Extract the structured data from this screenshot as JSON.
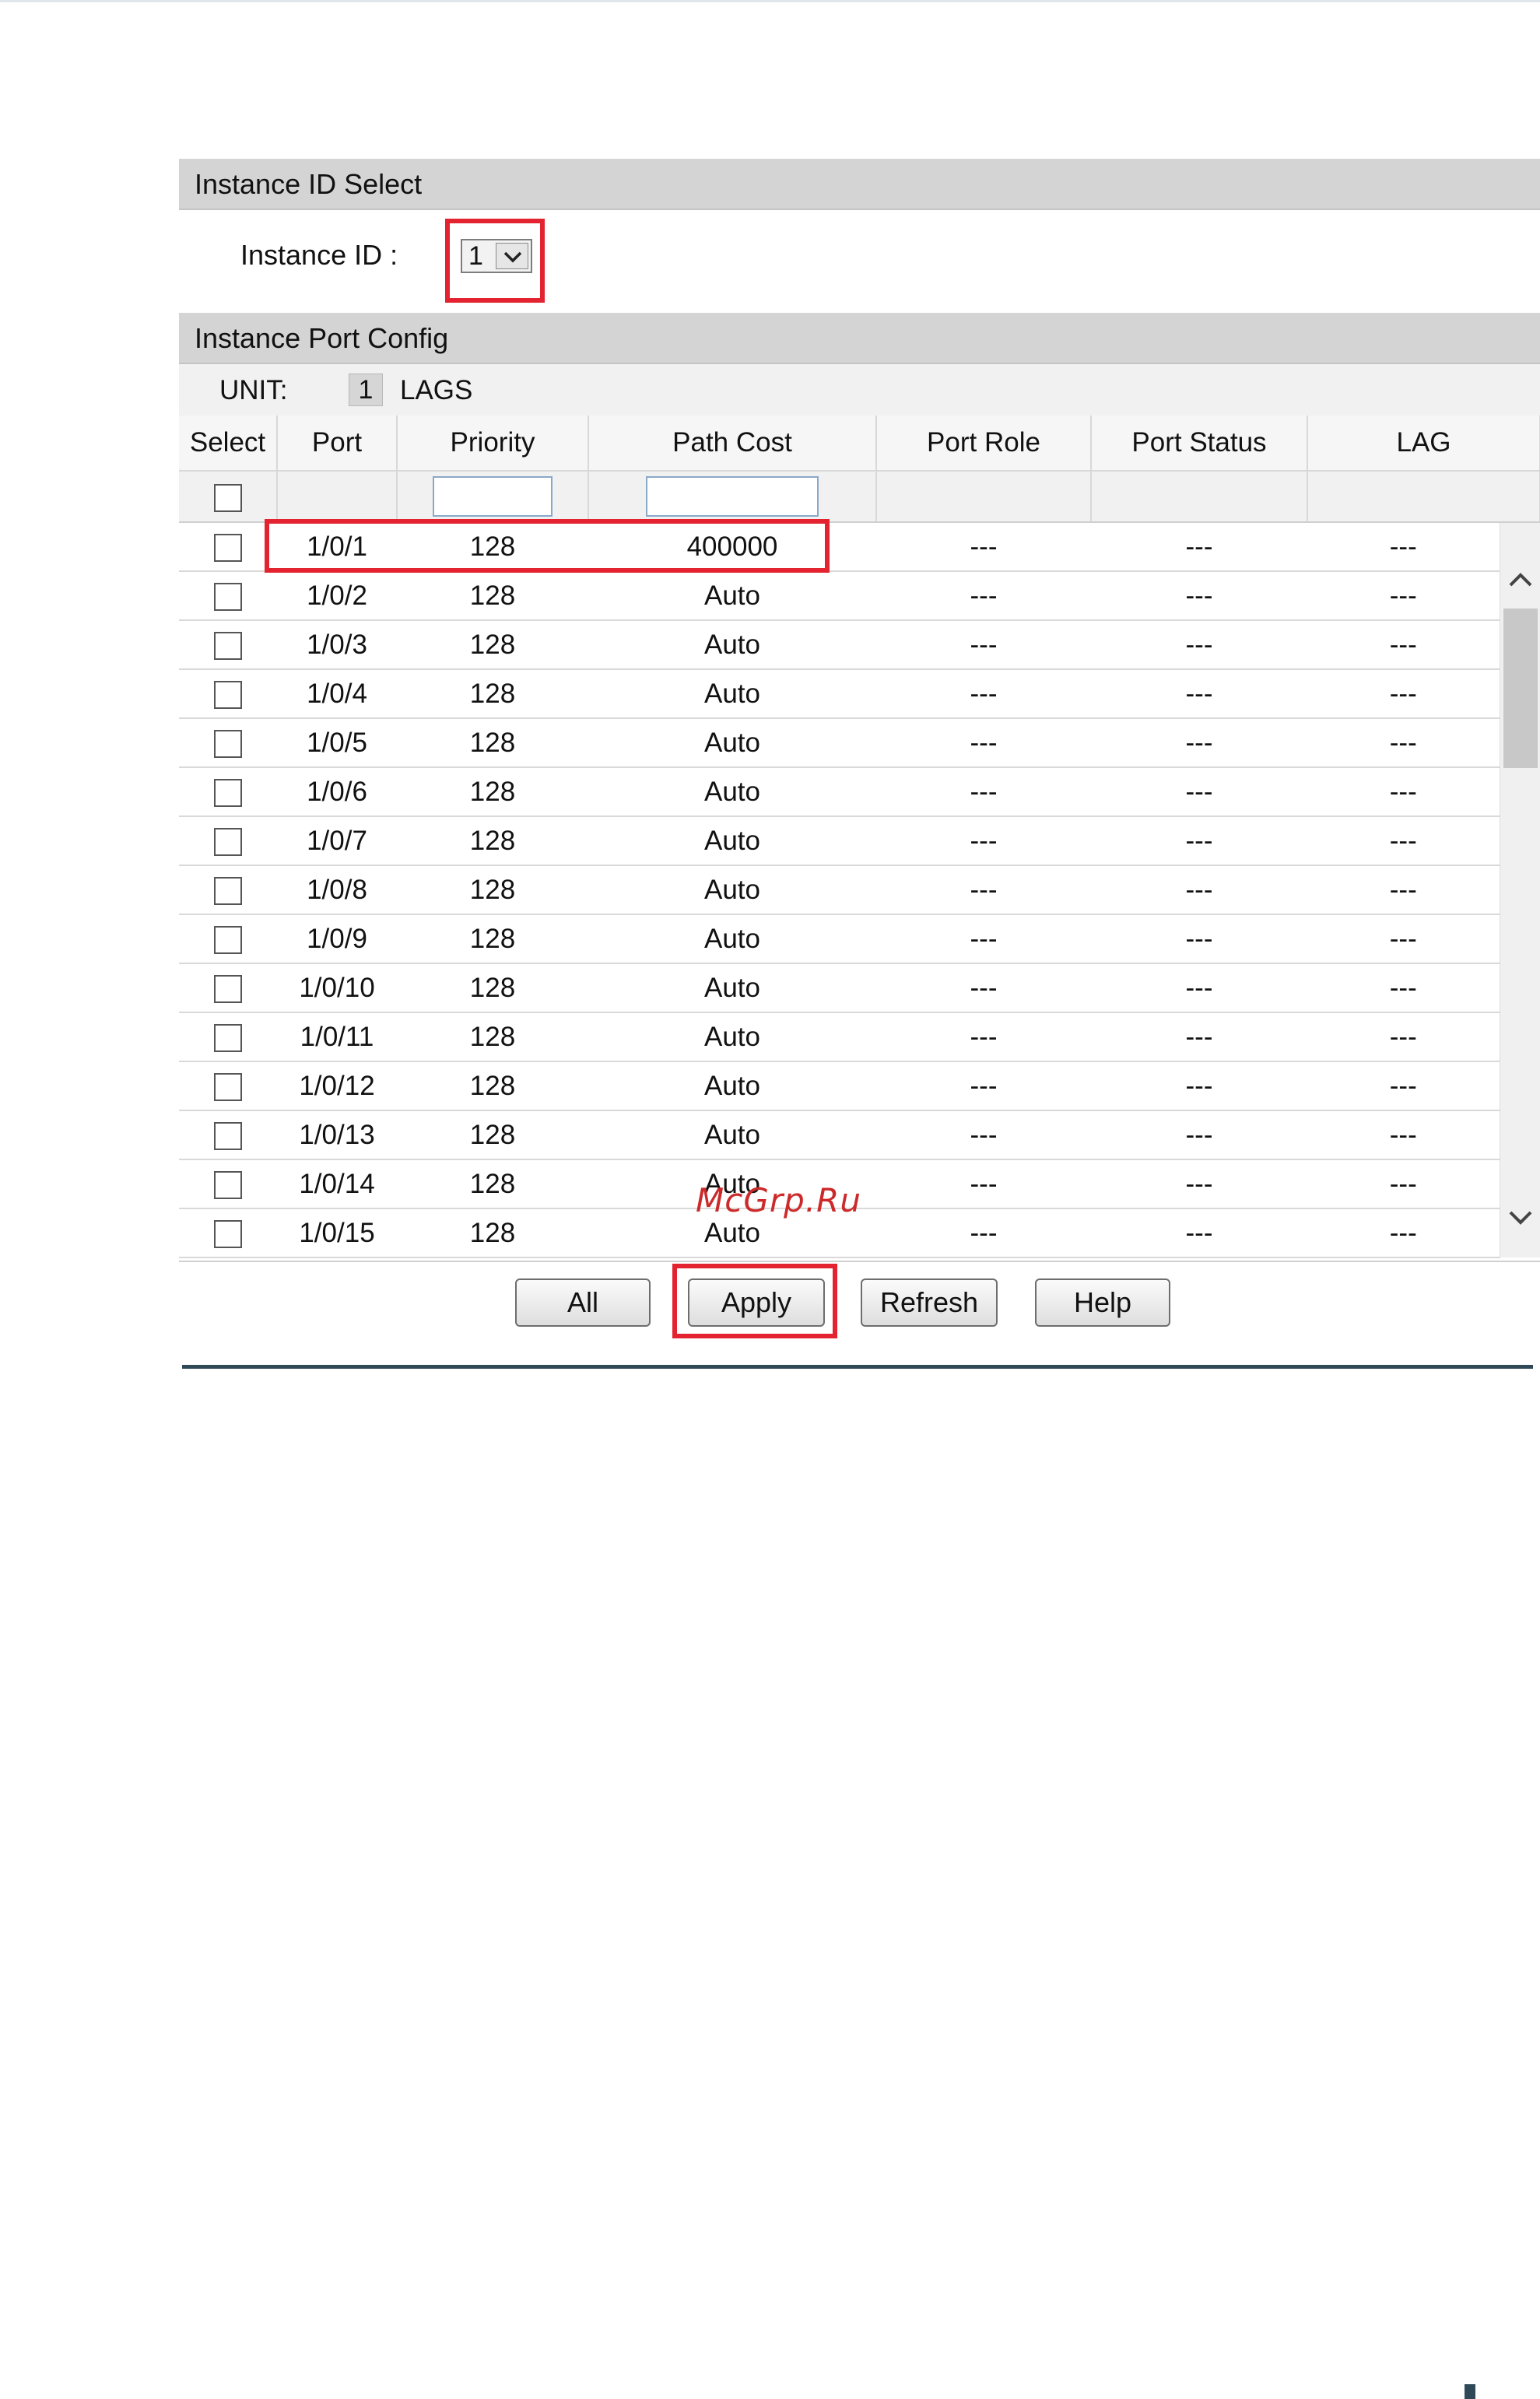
{
  "instance_select": {
    "header": "Instance ID Select",
    "label": "Instance ID :",
    "value": "1"
  },
  "port_config": {
    "header": "Instance Port Config",
    "unit_label": "UNIT:",
    "unit_value": "1",
    "lags_label": "LAGS",
    "columns": [
      "Select",
      "Port",
      "Priority",
      "Path Cost",
      "Port Role",
      "Port Status",
      "LAG"
    ],
    "filter": {
      "priority_value": "",
      "path_cost_value": ""
    },
    "rows": [
      {
        "port": "1/0/1",
        "priority": "128",
        "path_cost": "400000",
        "role": "---",
        "status": "---",
        "lag": "---"
      },
      {
        "port": "1/0/2",
        "priority": "128",
        "path_cost": "Auto",
        "role": "---",
        "status": "---",
        "lag": "---"
      },
      {
        "port": "1/0/3",
        "priority": "128",
        "path_cost": "Auto",
        "role": "---",
        "status": "---",
        "lag": "---"
      },
      {
        "port": "1/0/4",
        "priority": "128",
        "path_cost": "Auto",
        "role": "---",
        "status": "---",
        "lag": "---"
      },
      {
        "port": "1/0/5",
        "priority": "128",
        "path_cost": "Auto",
        "role": "---",
        "status": "---",
        "lag": "---"
      },
      {
        "port": "1/0/6",
        "priority": "128",
        "path_cost": "Auto",
        "role": "---",
        "status": "---",
        "lag": "---"
      },
      {
        "port": "1/0/7",
        "priority": "128",
        "path_cost": "Auto",
        "role": "---",
        "status": "---",
        "lag": "---"
      },
      {
        "port": "1/0/8",
        "priority": "128",
        "path_cost": "Auto",
        "role": "---",
        "status": "---",
        "lag": "---"
      },
      {
        "port": "1/0/9",
        "priority": "128",
        "path_cost": "Auto",
        "role": "---",
        "status": "---",
        "lag": "---"
      },
      {
        "port": "1/0/10",
        "priority": "128",
        "path_cost": "Auto",
        "role": "---",
        "status": "---",
        "lag": "---"
      },
      {
        "port": "1/0/11",
        "priority": "128",
        "path_cost": "Auto",
        "role": "---",
        "status": "---",
        "lag": "---"
      },
      {
        "port": "1/0/12",
        "priority": "128",
        "path_cost": "Auto",
        "role": "---",
        "status": "---",
        "lag": "---"
      },
      {
        "port": "1/0/13",
        "priority": "128",
        "path_cost": "Auto",
        "role": "---",
        "status": "---",
        "lag": "---"
      },
      {
        "port": "1/0/14",
        "priority": "128",
        "path_cost": "Auto",
        "role": "---",
        "status": "---",
        "lag": "---"
      },
      {
        "port": "1/0/15",
        "priority": "128",
        "path_cost": "Auto",
        "role": "---",
        "status": "---",
        "lag": "---"
      }
    ]
  },
  "buttons": {
    "all": "All",
    "apply": "Apply",
    "refresh": "Refresh",
    "help": "Help"
  },
  "watermark": "McGrp.Ru",
  "colors": {
    "highlight": "#e3232f",
    "header_bg": "#d4d4d4",
    "rule": "#2f4957"
  }
}
